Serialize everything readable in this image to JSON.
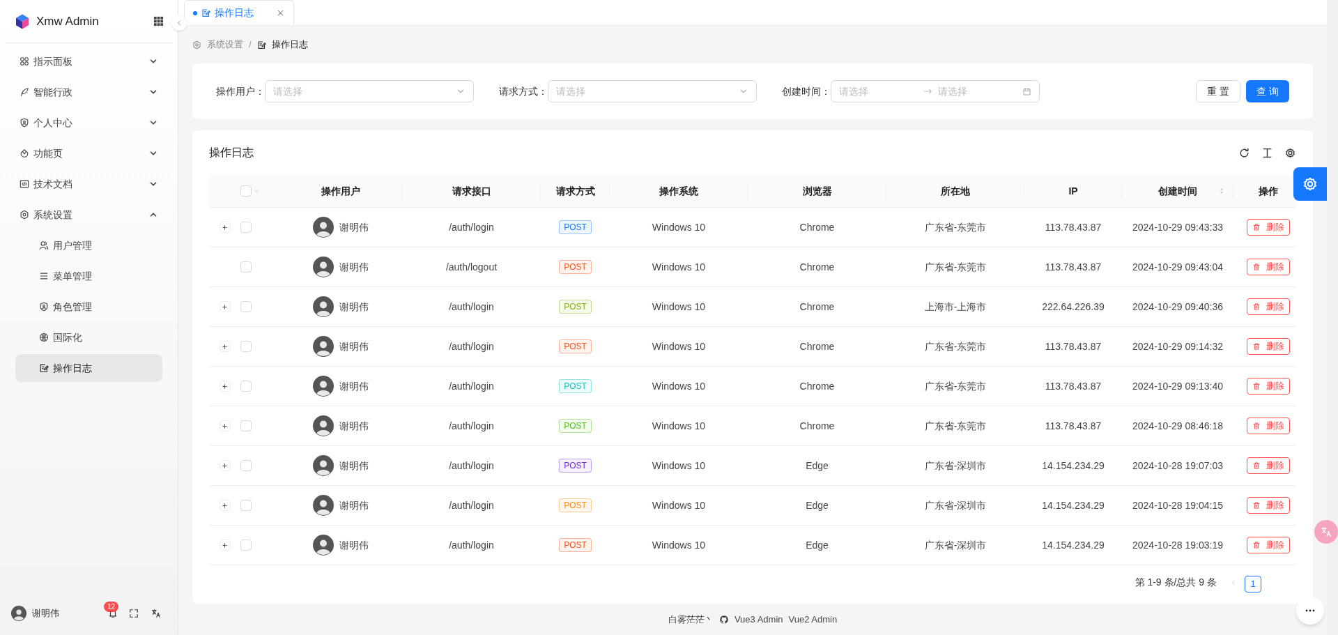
{
  "sidebar": {
    "logo_text": "Xmw Admin",
    "items": [
      {
        "label": "指示面板",
        "expanded": false
      },
      {
        "label": "智能行政",
        "expanded": false
      },
      {
        "label": "个人中心",
        "expanded": false
      },
      {
        "label": "功能页",
        "expanded": false
      },
      {
        "label": "技术文档",
        "expanded": false
      },
      {
        "label": "系统设置",
        "expanded": true,
        "children": [
          {
            "label": "用户管理",
            "selected": false
          },
          {
            "label": "菜单管理",
            "selected": false
          },
          {
            "label": "角色管理",
            "selected": false
          },
          {
            "label": "国际化",
            "selected": false
          },
          {
            "label": "操作日志",
            "selected": true
          }
        ]
      }
    ],
    "user": {
      "name": "谢明伟",
      "badge": "12"
    }
  },
  "tabs": [
    {
      "label": "操作日志",
      "selected": true
    }
  ],
  "breadcrumb": {
    "separator": "/",
    "items": [
      "系统设置",
      "操作日志"
    ]
  },
  "filters": [
    {
      "label": "操作用户：",
      "placeholder": "请选择",
      "kind": "select"
    },
    {
      "label": "请求方式：",
      "placeholder": "请选择",
      "kind": "select"
    },
    {
      "label": "创建时间：",
      "placeholder": "请选择",
      "end_placeholder": "请选择",
      "kind": "range"
    }
  ],
  "buttons": [
    "重 置",
    "查 询"
  ],
  "table": {
    "title": "操作日志",
    "header_checked": false,
    "columns": [
      {
        "label": "操作用户"
      },
      {
        "label": "请求接口"
      },
      {
        "label": "请求方式"
      },
      {
        "label": "操作系统"
      },
      {
        "label": "浏览器"
      },
      {
        "label": "所在地"
      },
      {
        "label": "IP"
      },
      {
        "label": "创建时间",
        "sortable": true
      },
      {
        "label": "操作"
      }
    ],
    "rows": [
      {
        "expandable": true,
        "checked": false,
        "user": "谢明伟",
        "path": "/auth/login",
        "method": "POST",
        "color": "#1677ff",
        "os": "Windows 10",
        "browser": "Chrome",
        "location": "广东省-东莞市",
        "ip": "113.78.43.87",
        "time": "2024-10-29 09:43:33",
        "action": "删除"
      },
      {
        "expandable": false,
        "checked": false,
        "user": "谢明伟",
        "path": "/auth/logout",
        "method": "POST",
        "color": "#fa541c",
        "os": "Windows 10",
        "browser": "Chrome",
        "location": "广东省-东莞市",
        "ip": "113.78.43.87",
        "time": "2024-10-29 09:43:04",
        "action": "删除"
      },
      {
        "expandable": true,
        "checked": false,
        "user": "谢明伟",
        "path": "/auth/login",
        "method": "POST",
        "color": "#7cb305",
        "os": "Windows 10",
        "browser": "Chrome",
        "location": "上海市-上海市",
        "ip": "222.64.226.39",
        "time": "2024-10-29 09:40:36",
        "action": "删除"
      },
      {
        "expandable": true,
        "checked": false,
        "user": "谢明伟",
        "path": "/auth/login",
        "method": "POST",
        "color": "#fa541c",
        "os": "Windows 10",
        "browser": "Chrome",
        "location": "广东省-东莞市",
        "ip": "113.78.43.87",
        "time": "2024-10-29 09:14:32",
        "action": "删除"
      },
      {
        "expandable": true,
        "checked": false,
        "user": "谢明伟",
        "path": "/auth/login",
        "method": "POST",
        "color": "#13c2c2",
        "os": "Windows 10",
        "browser": "Chrome",
        "location": "广东省-东莞市",
        "ip": "113.78.43.87",
        "time": "2024-10-29 09:13:40",
        "action": "删除"
      },
      {
        "expandable": true,
        "checked": false,
        "user": "谢明伟",
        "path": "/auth/login",
        "method": "POST",
        "color": "#52c41a",
        "os": "Windows 10",
        "browser": "Chrome",
        "location": "广东省-东莞市",
        "ip": "113.78.43.87",
        "time": "2024-10-29 08:46:18",
        "action": "删除"
      },
      {
        "expandable": true,
        "checked": false,
        "user": "谢明伟",
        "path": "/auth/login",
        "method": "POST",
        "color": "#722ed1",
        "os": "Windows 10",
        "browser": "Edge",
        "location": "广东省-深圳市",
        "ip": "14.154.234.29",
        "time": "2024-10-28 19:07:03",
        "action": "删除"
      },
      {
        "expandable": true,
        "checked": false,
        "user": "谢明伟",
        "path": "/auth/login",
        "method": "POST",
        "color": "#fa8c16",
        "os": "Windows 10",
        "browser": "Edge",
        "location": "广东省-深圳市",
        "ip": "14.154.234.29",
        "time": "2024-10-28 19:04:15",
        "action": "删除"
      },
      {
        "expandable": true,
        "checked": false,
        "user": "谢明伟",
        "path": "/auth/login",
        "method": "POST",
        "color": "#fa541c",
        "os": "Windows 10",
        "browser": "Edge",
        "location": "广东省-深圳市",
        "ip": "14.154.234.29",
        "time": "2024-10-28 19:03:19",
        "action": "删除"
      }
    ]
  },
  "pagination": {
    "summary": "第 1-9 条/总共 9 条",
    "pages": [
      {
        "label": "1",
        "selected": true
      }
    ]
  },
  "footer": {
    "author": "白雾茫茫丶",
    "links": [
      "Vue3 Admin",
      "Vue2 Admin"
    ]
  }
}
